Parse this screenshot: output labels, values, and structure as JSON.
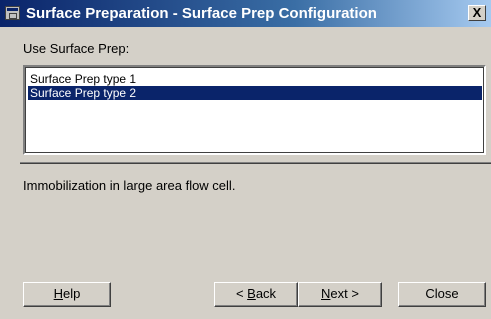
{
  "window": {
    "title": "Surface Preparation - Surface Prep Configuration",
    "close_label": "X"
  },
  "form": {
    "label": "Use Surface Prep:",
    "list": {
      "items": [
        "Surface Prep type 1",
        "Surface Prep type 2"
      ],
      "selected_index": 1
    },
    "description": "Immobilization in large area flow cell."
  },
  "buttons": {
    "help": {
      "pre": "",
      "mnemonic": "H",
      "post": "elp"
    },
    "back": {
      "pre": "< ",
      "mnemonic": "B",
      "post": "ack"
    },
    "next": {
      "pre": "",
      "mnemonic": "N",
      "post": "ext >"
    },
    "close": {
      "pre": "Close",
      "mnemonic": "",
      "post": ""
    }
  }
}
